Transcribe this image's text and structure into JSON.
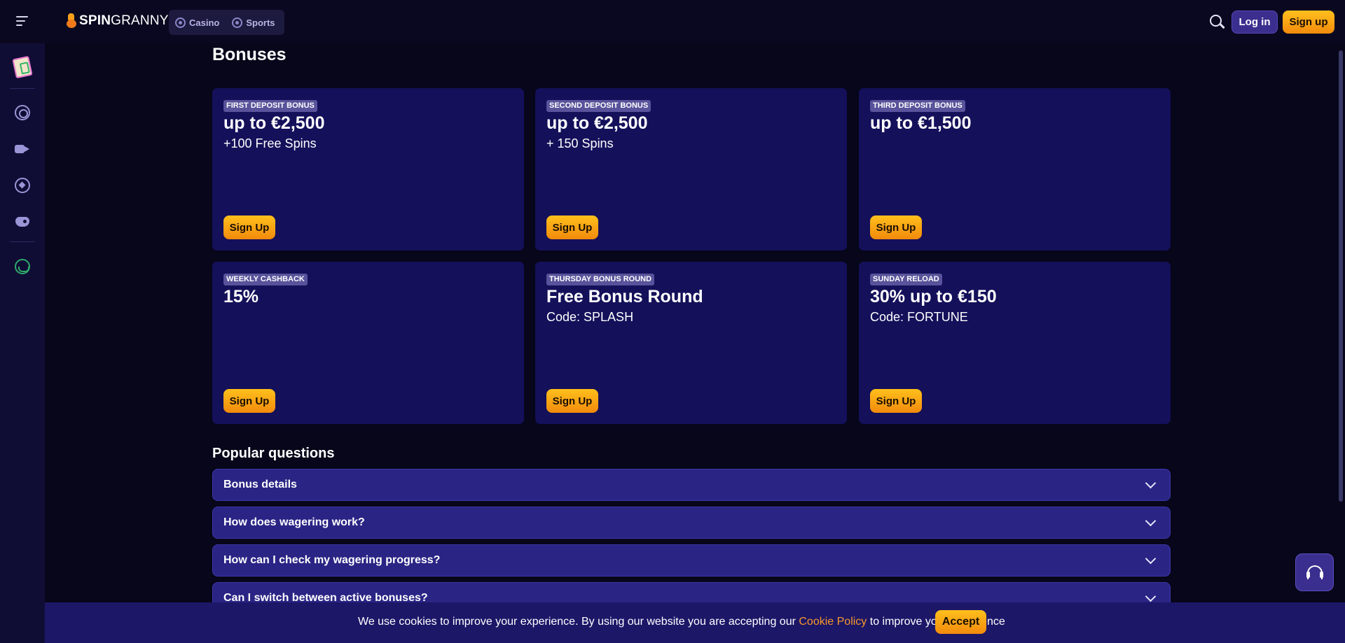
{
  "brand": {
    "logo_bold": "SPIN",
    "logo_light": "GRANNY",
    "accent": "#f6a01a",
    "background": "#07061a",
    "card_bg": "#14105a"
  },
  "header": {
    "nav": [
      {
        "label": "Casino",
        "icon": "casino-chip-icon"
      },
      {
        "label": "Sports",
        "icon": "soccer-ball-icon"
      }
    ],
    "login_label": "Log in",
    "signup_label": "Sign up"
  },
  "sidebar": {
    "items": [
      {
        "name": "promotions",
        "icon": "promo-bag-icon"
      },
      {
        "name": "casino",
        "icon": "casino-chip-icon"
      },
      {
        "name": "live-casino",
        "icon": "live-camera-icon"
      },
      {
        "name": "sports",
        "icon": "soccer-ball-icon"
      },
      {
        "name": "esports",
        "icon": "gamepad-icon"
      },
      {
        "name": "support",
        "icon": "headset-icon"
      }
    ]
  },
  "page": {
    "title": "Bonuses",
    "bonuses": [
      {
        "tag": "First deposit bonus",
        "headline": "up to €2,500",
        "sub": "+100 Free Spins",
        "cta": "Sign Up"
      },
      {
        "tag": "Second deposit bonus",
        "headline": "up to €2,500",
        "sub": "+ 150 Spins",
        "cta": "Sign Up"
      },
      {
        "tag": "Third deposit bonus",
        "headline": "up to €1,500",
        "sub": "",
        "cta": "Sign Up"
      },
      {
        "tag": "Weekly cashback",
        "headline": "15%",
        "sub": "",
        "cta": "Sign Up"
      },
      {
        "tag": "Thursday bonus round",
        "headline": "Free Bonus Round",
        "sub": "Code: SPLASH",
        "cta": "Sign Up"
      },
      {
        "tag": "Sunday reload",
        "headline": "30% up to €150",
        "sub": "Code: FORTUNE",
        "cta": "Sign Up"
      }
    ],
    "faq_title": "Popular questions",
    "faq": [
      {
        "question": "Bonus details"
      },
      {
        "question": "How does wagering work?"
      },
      {
        "question": "How can I check my wagering progress?"
      },
      {
        "question": "Can I switch between active bonuses?"
      }
    ]
  },
  "cookie": {
    "text_before": "We use cookies to improve your experience. By using our website you are accepting our ",
    "link": "Cookie Policy",
    "text_after": " to improve your experience",
    "accept_label": "Accept"
  }
}
